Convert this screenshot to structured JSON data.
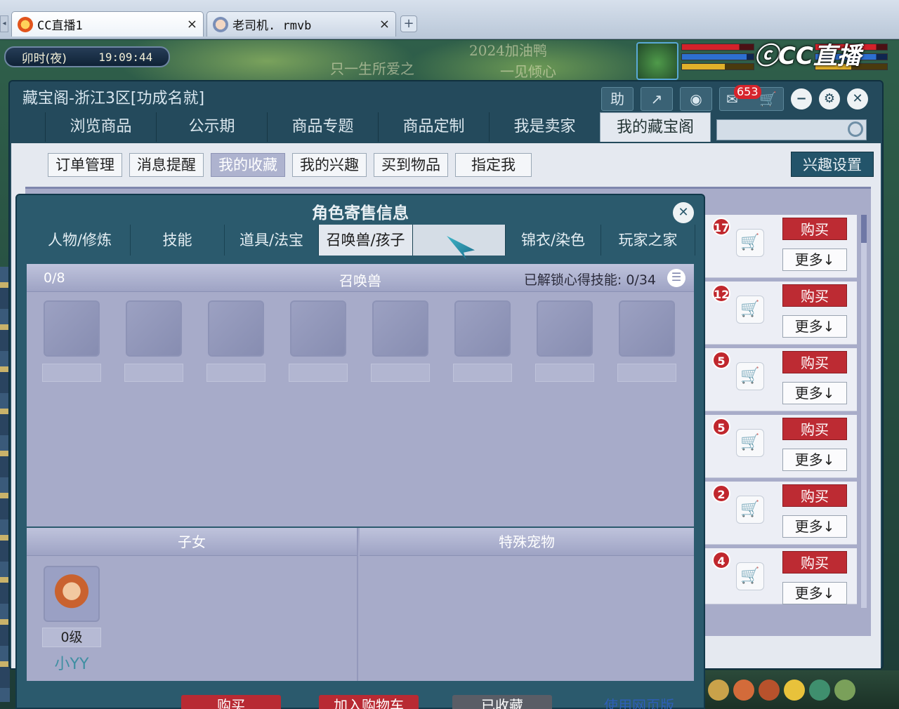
{
  "browser": {
    "tabs": [
      {
        "label": "CC直播1",
        "active": true
      },
      {
        "label": "老司机. rmvb",
        "active": false
      }
    ],
    "new_tab": "+",
    "close_glyph": "×"
  },
  "game": {
    "clock_period": "卯时(夜)",
    "clock_time": "19:09:44",
    "banner_left": "只一生所爱之",
    "banner_center": "2024加油鸭",
    "banner_right": "一见倾心",
    "watermark": "CC直播"
  },
  "window": {
    "title": "藏宝阁-浙江3区[功成名就]",
    "help_label": "助",
    "message_count": "653",
    "main_tabs": [
      "浏览商品",
      "公示期",
      "商品专题",
      "商品定制",
      "我是卖家",
      "我的藏宝阁"
    ],
    "active_main_tab": "我的藏宝阁",
    "search_placeholder": "",
    "sub_tabs": [
      "订单管理",
      "消息提醒",
      "我的收藏",
      "我的兴趣",
      "买到物品",
      "指定我"
    ],
    "active_sub_tab": "我的收藏",
    "interest_settings": "兴趣设置"
  },
  "list": {
    "rows": [
      {
        "count": "17",
        "buy": "购买",
        "more": "更多↓"
      },
      {
        "count": "12",
        "buy": "购买",
        "more": "更多↓"
      },
      {
        "count": "5",
        "buy": "购买",
        "more": "更多↓"
      },
      {
        "count": "5",
        "buy": "购买",
        "more": "更多↓"
      },
      {
        "count": "2",
        "buy": "购买",
        "more": "更多↓"
      },
      {
        "count": "4",
        "buy": "购买",
        "more": "更多↓"
      }
    ]
  },
  "dialog": {
    "title": "角色寄售信息",
    "tabs": [
      "人物/修炼",
      "技能",
      "道具/法宝",
      "召唤兽/孩子",
      "",
      "锦衣/染色",
      "玩家之家"
    ],
    "active_tab": "召唤兽/孩子",
    "pets": {
      "count": "0/8",
      "heading": "召唤兽",
      "unlocked_label": "已解锁心得技能:",
      "unlocked_value": "0/34",
      "slot_count": 8
    },
    "children": {
      "heading": "子女",
      "items": [
        {
          "level": "0级",
          "name": "小YY"
        }
      ]
    },
    "special_pets": {
      "heading": "特殊宠物"
    },
    "actions": {
      "buy": "购买",
      "add_cart": "加入购物车",
      "favorited": "已收藏",
      "web_version": "使用网页版"
    }
  },
  "colors": {
    "buy_red": "#bd2b33",
    "panel_purple": "#a7abc9",
    "window_teal": "#244a5c",
    "child_name": "#3f8fa2"
  }
}
